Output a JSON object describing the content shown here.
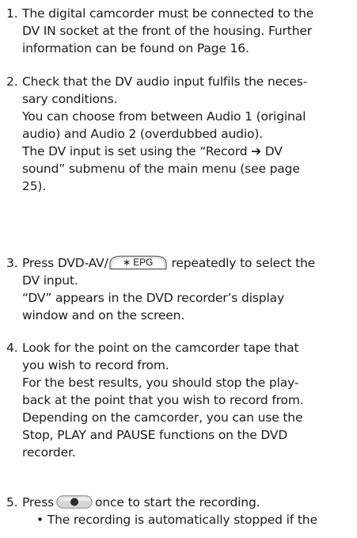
{
  "steps": [
    {
      "number": "1.",
      "lines": [
        "The digital camcorder must be connected to the",
        "DV IN socket at the front of the housing. Further",
        "information can be found on Page 16."
      ]
    },
    {
      "number": "2.",
      "lines": [
        "Check that the DV audio input fulfils the neces-",
        "sary conditions.",
        "You can choose from between Audio 1 (original",
        "audio) and Audio 2 (overdubbed audio).",
        "The DV input is set using the “Record ➔ DV",
        "sound” submenu of the main menu (see page",
        "25)."
      ]
    },
    {
      "number": "3.",
      "pre_key": "Press DVD-AV/",
      "key_label": "∗ EPG",
      "post_key": " repeatedly to select the",
      "lines": [
        "DV input.",
        "“DV” appears in the DVD recorder’s display",
        "window and on the screen."
      ]
    },
    {
      "number": "4.",
      "lines": [
        "Look for the point on the camcorder tape that",
        "you wish to record from.",
        "For the best results, you should stop the play-",
        "back at the point that you wish to record from.",
        "Depending on the camcorder, you can use the",
        "Stop, PLAY and PAUSE functions on the DVD",
        "recorder."
      ]
    },
    {
      "number": "5.",
      "pre_key": "Press",
      "post_key": "once to start the recording.",
      "bullet": "• The recording is automatically stopped if the"
    }
  ]
}
